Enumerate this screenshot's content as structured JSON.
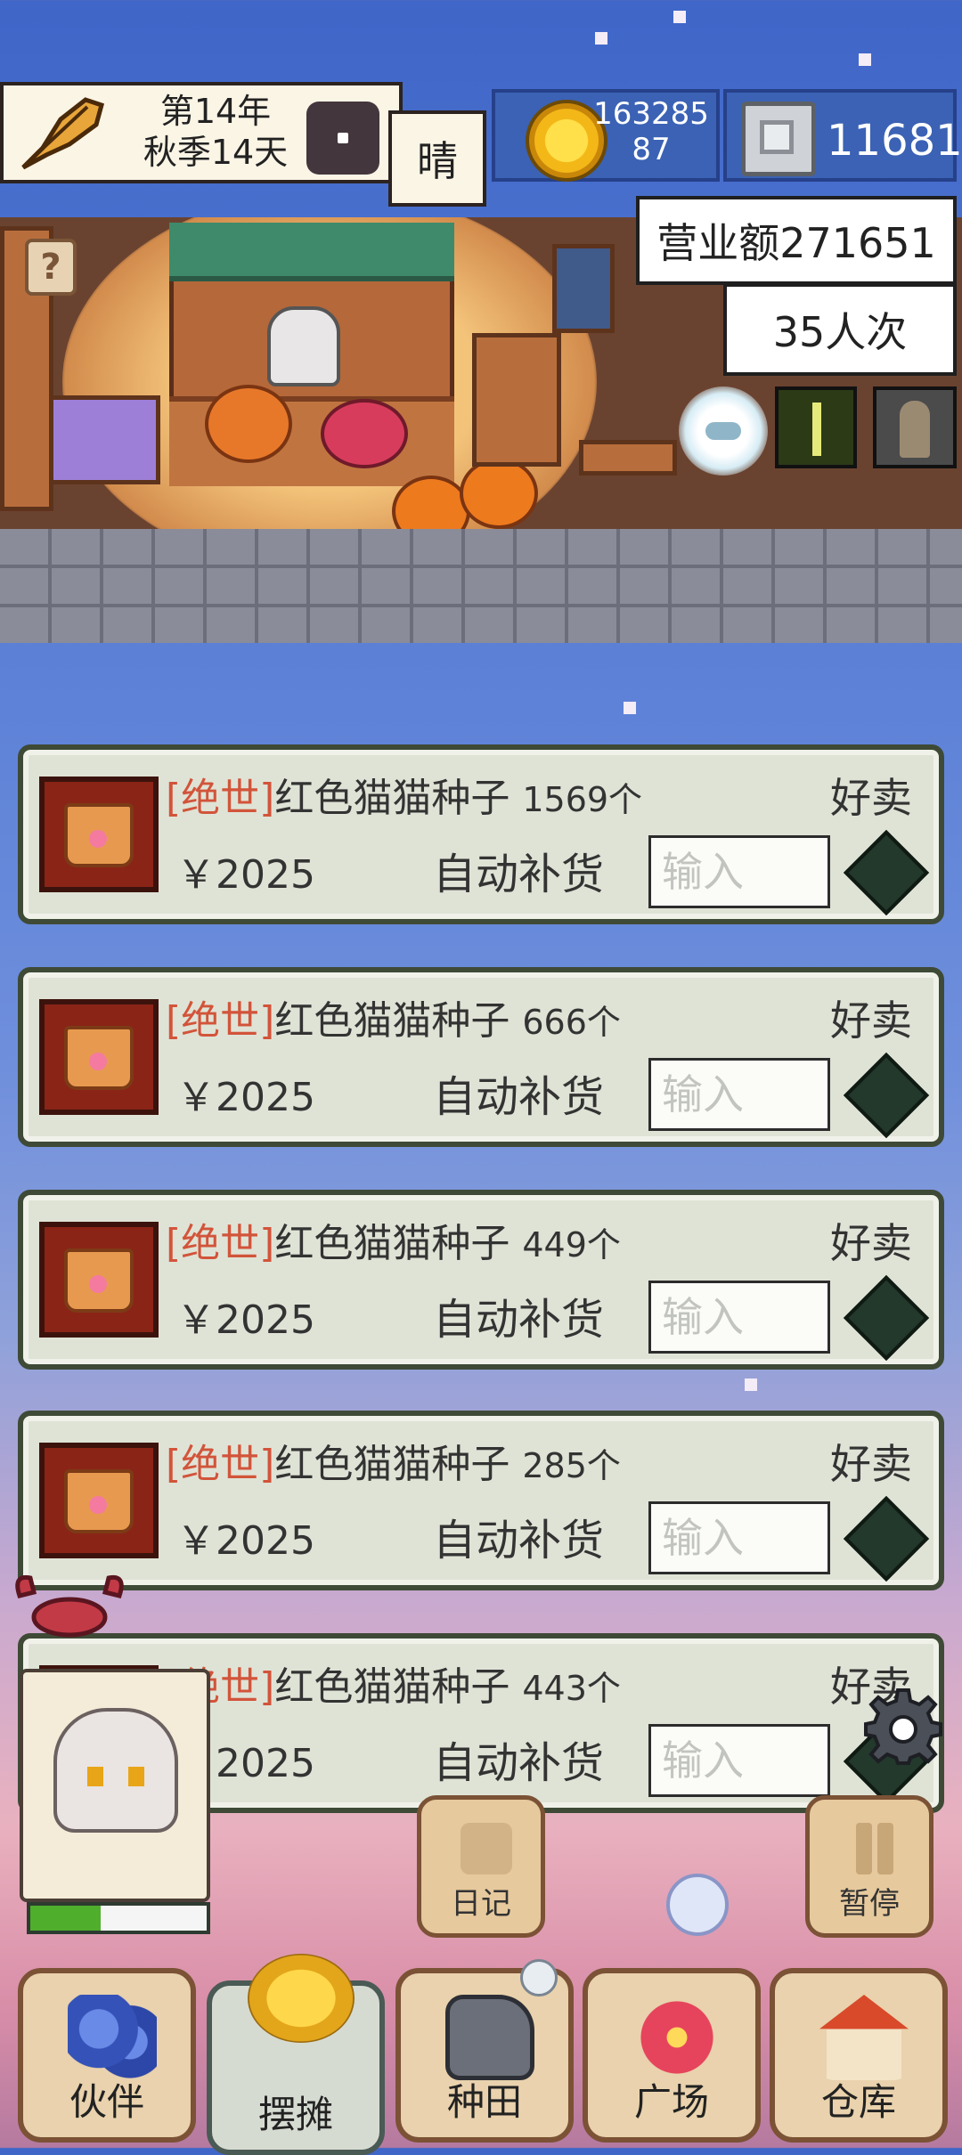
{
  "hud": {
    "date_line1": "第14年",
    "date_line2": "秋季14天",
    "weather": "晴",
    "coins_line1": "163285",
    "coins_line2": "87",
    "gems": "11681",
    "revenue": "营业额271651",
    "visitors": "35人次"
  },
  "scene": {
    "help_symbol": "?"
  },
  "items": [
    {
      "rarity": "[绝世]",
      "name": "红色猫猫种子",
      "count": "1569个",
      "tag": "好卖",
      "price": "￥2025",
      "auto_restock_label": "自动补货",
      "input_placeholder": "输入"
    },
    {
      "rarity": "[绝世]",
      "name": "红色猫猫种子",
      "count": "666个",
      "tag": "好卖",
      "price": "￥2025",
      "auto_restock_label": "自动补货",
      "input_placeholder": "输入"
    },
    {
      "rarity": "[绝世]",
      "name": "红色猫猫种子",
      "count": "449个",
      "tag": "好卖",
      "price": "￥2025",
      "auto_restock_label": "自动补货",
      "input_placeholder": "输入"
    },
    {
      "rarity": "[绝世]",
      "name": "红色猫猫种子",
      "count": "285个",
      "tag": "好卖",
      "price": "￥2025",
      "auto_restock_label": "自动补货",
      "input_placeholder": "输入"
    },
    {
      "rarity": "[绝世]",
      "name": "红色猫猫种子",
      "count": "443个",
      "tag": "好卖",
      "price": "￥2025",
      "auto_restock_label": "自动补货",
      "input_placeholder": "输入"
    }
  ],
  "companion": {
    "stamina_fraction": 0.4
  },
  "side_buttons": {
    "diary": "日记",
    "pause": "暂停"
  },
  "nav": {
    "partner": "伙伴",
    "stall": "摆摊",
    "farm": "种田",
    "plaza": "广场",
    "storage": "仓库",
    "active": "stall"
  },
  "colors": {
    "rarity": "#d2543a",
    "card_bg": "#dfe3d6",
    "stamina": "#4fae2c"
  }
}
